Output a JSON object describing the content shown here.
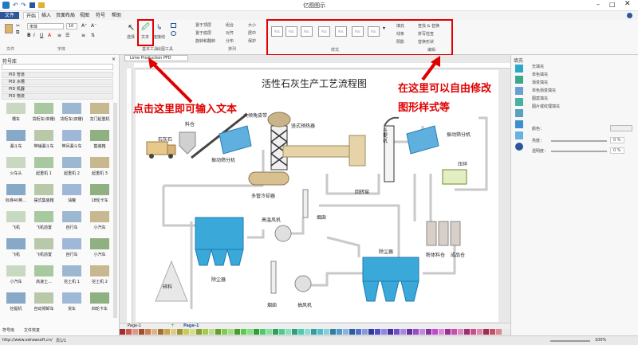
{
  "app": {
    "title": "亿图图示",
    "file_menu": "文件"
  },
  "menus": [
    "开始",
    "插入",
    "页面布局",
    "视图",
    "符号",
    "帮助"
  ],
  "ribbon": {
    "font_name": "宋体",
    "font_size": "10",
    "select_label": "选择",
    "text_label": "文本",
    "connector_label": "连接线",
    "drawing_tools_label": "绘图工具",
    "arrange": [
      "置于顶层",
      "置于底层",
      "旋转和翻转",
      "组合",
      "对齐",
      "分布",
      "大小",
      "居中",
      "保护"
    ],
    "edit_items": [
      "查找 & 替换",
      "拼写检查",
      "替换形状"
    ],
    "fill_items": [
      "填充",
      "线条",
      "阴影"
    ],
    "groups": {
      "file": "文件",
      "font": "字体",
      "basic_tools": "基本工具",
      "arrange": "排列",
      "styles": "样式",
      "edit": "编辑"
    }
  },
  "left_panel": {
    "title": "符号库",
    "libraries": [
      "PID 管道",
      "PID 水槽",
      "PID 机器",
      "PID 物流"
    ],
    "symbols": [
      "槽车",
      "货柜车(单栅)",
      "货柜车(双栅)",
      "龙门起重机",
      "漏斗车",
      "带铺漏斗车",
      "带吊漏斗车",
      "集装箱",
      "火车头",
      "起重机 1",
      "起重机 2",
      "起重机 3",
      "标准40英...",
      "摆式集装箱",
      "油罐",
      "18轮卡车",
      "飞机",
      "飞机前置",
      "自行车",
      "小汽车",
      "飞机",
      "飞机前置",
      "自行车",
      "小汽车",
      "小汽车",
      "高速土...",
      "挖土机 1",
      "挖土机 2",
      "挖掘机",
      "自动倾卸车",
      "货车",
      "四轮卡车"
    ],
    "bottom_tabs": [
      "符号库",
      "文件恢复"
    ]
  },
  "document_tab": "Lime Production PFD",
  "diagram": {
    "title": "活性石灰生产工艺流程图",
    "labels": [
      "石灰石",
      "料仓",
      "大倾角皮带",
      "竖式预热器",
      "振动筛分机",
      "多管冷却器",
      "斗提机",
      "振动筛分机",
      "压碎",
      "高温风机",
      "烟囱",
      "成品仓",
      "粉体料仓",
      "除尘器",
      "除尘器",
      "碎料",
      "烟囱",
      "抽风机",
      "斗式提升机",
      "回转窑"
    ],
    "note_hoist": "斗式提升机"
  },
  "annotations": {
    "left": "点击这里即可输入文本",
    "right_line1": "在这里可以自由修改",
    "right_line2": "图形样式等"
  },
  "right_panel": {
    "title": "填充",
    "fill_options": [
      "无填充",
      "单色填充",
      "渐变填充",
      "单色渐变填充",
      "图案填充",
      "图片或纹理填充"
    ],
    "color_label": "颜色：",
    "brightness_label": "亮度：",
    "transparency_label": "透明度：",
    "brightness_value": "0 %",
    "transparency_value": "0 %"
  },
  "page_tabs": {
    "page": "Page-1",
    "active": "Page-1"
  },
  "status": {
    "url": "http://www.edrawsoft.cn/",
    "page_info": "页1/1",
    "zoom": "100%"
  },
  "colors": {
    "accent": "#2b579a",
    "annotation": "#e00000",
    "equipment_blue": "#3aa8d8"
  }
}
